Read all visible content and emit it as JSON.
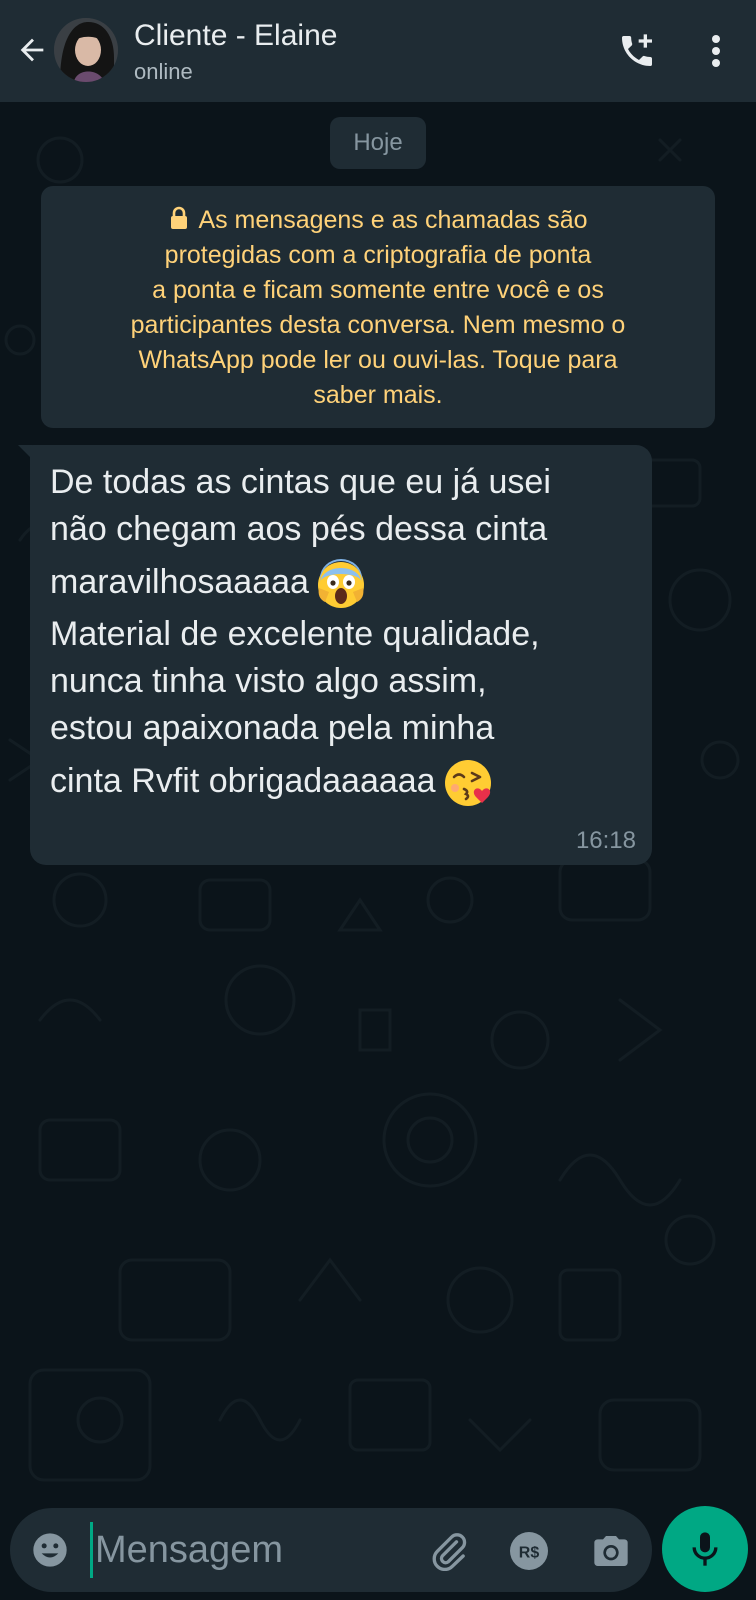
{
  "header": {
    "contact_name": "Cliente - Elaine",
    "status": "online",
    "back_icon": "arrow-left-icon",
    "call_icon": "add-call-icon",
    "menu_icon": "more-vertical-icon"
  },
  "chat": {
    "date_chip": "Hoje",
    "encryption_notice": {
      "lock_icon": "lock-icon",
      "lines": [
        "As mensagens e as chamadas são",
        "protegidas com a criptografia de ponta",
        "a ponta e ficam somente entre você e os",
        "participantes desta conversa. Nem mesmo o",
        "WhatsApp pode ler ou ouvi-las. Toque para",
        "saber mais."
      ],
      "color": "#ffd279"
    },
    "messages": [
      {
        "direction": "incoming",
        "lines": [
          "De todas as cintas que eu já usei",
          "não chegam aos pés dessa cinta",
          "maravilhosaaaaa",
          "Material de excelente qualidade,",
          "nunca tinha visto algo assim,",
          "estou apaixonada pela minha",
          "cinta Rvfit obrigadaaaaaa"
        ],
        "emojis": [
          "face-screaming-emoji",
          "face-blowing-kiss-emoji"
        ],
        "time": "16:18"
      }
    ]
  },
  "composer": {
    "placeholder": "Mensagem",
    "emoji_icon": "emoji-icon",
    "attach_icon": "paperclip-icon",
    "payment_icon": "payment-rs-icon",
    "payment_label": "R$",
    "camera_icon": "camera-icon",
    "mic_icon": "microphone-icon"
  },
  "colors": {
    "background": "#0b141a",
    "panel": "#1f2c34",
    "accent": "#00a884",
    "text_primary": "#e9edef",
    "text_secondary": "#8696a0"
  }
}
